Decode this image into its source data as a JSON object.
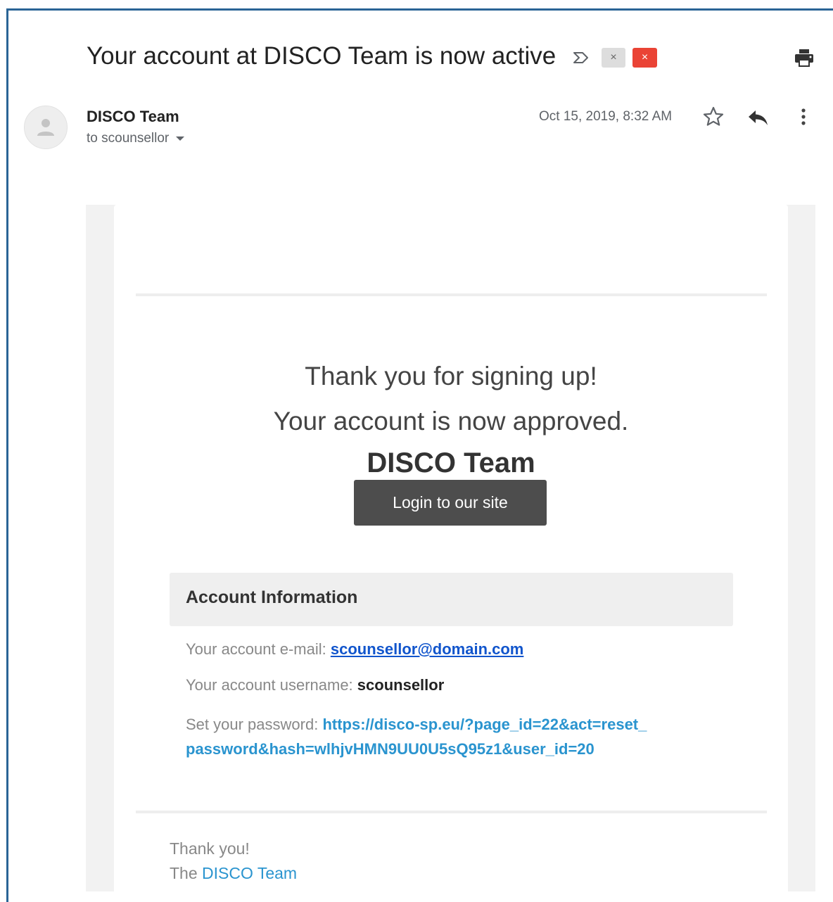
{
  "subject": "Your account at DISCO Team is now active",
  "labels": {
    "inbox_chip": "×",
    "remove_chip": "×"
  },
  "sender": {
    "name": "DISCO Team",
    "recipient": "to scounsellor",
    "date": "Oct 15, 2019, 8:32 AM"
  },
  "icons": [
    "important-icon",
    "print-icon",
    "avatar-icon",
    "star-icon",
    "reply-icon",
    "more-options-icon"
  ],
  "email": {
    "title": "DISCO Team",
    "thanks": "Thank you for signing up!",
    "approved": "Your account is now approved.",
    "login_button": "Login to our site",
    "account_info": {
      "header": "Account Information",
      "email_label": "Your account e-mail: ",
      "email_value": "scounsellor@domain.com",
      "username_label": "Your account username: ",
      "username_value": "scounsellor",
      "password_label": "Set your password: ",
      "password_link_line1": "https://disco-sp.eu/?page_id=22&act=reset_",
      "password_link_line2": "password&hash=wlhjvHMN9UU0U5sQ95z1&user_id=20"
    },
    "signoff": "Thank you!",
    "signature_prefix": "The ",
    "signature_link": "DISCO Team"
  },
  "colors": {
    "frame": "#2a6496",
    "button_bg": "#4d4d4d",
    "link_blue": "#1155cc",
    "link_light_blue": "#2a94cf",
    "label_red": "#ea4335"
  }
}
